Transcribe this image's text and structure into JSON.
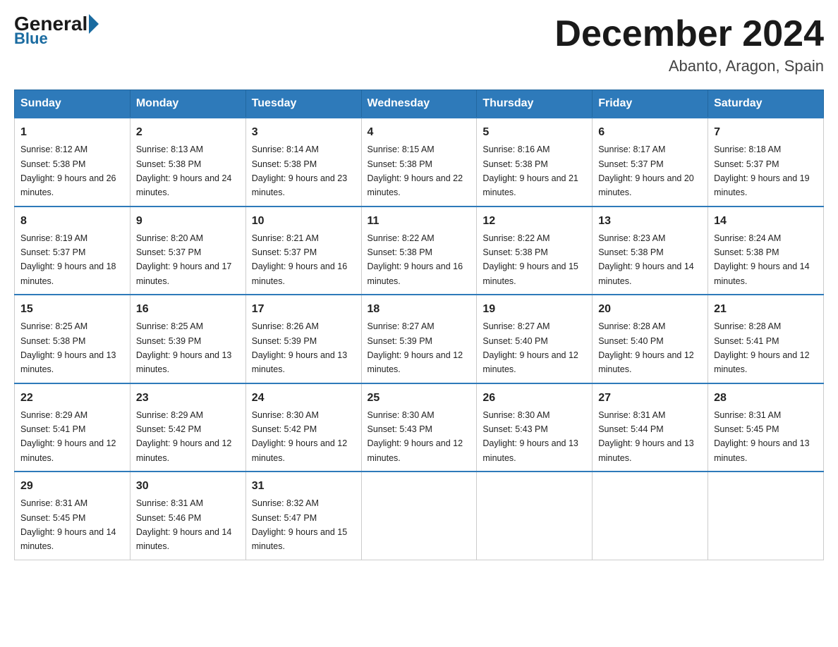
{
  "header": {
    "logo_general": "General",
    "logo_blue": "Blue",
    "month_title": "December 2024",
    "location": "Abanto, Aragon, Spain"
  },
  "days_of_week": [
    "Sunday",
    "Monday",
    "Tuesday",
    "Wednesday",
    "Thursday",
    "Friday",
    "Saturday"
  ],
  "weeks": [
    [
      {
        "day": "1",
        "sunrise": "8:12 AM",
        "sunset": "5:38 PM",
        "daylight": "9 hours and 26 minutes."
      },
      {
        "day": "2",
        "sunrise": "8:13 AM",
        "sunset": "5:38 PM",
        "daylight": "9 hours and 24 minutes."
      },
      {
        "day": "3",
        "sunrise": "8:14 AM",
        "sunset": "5:38 PM",
        "daylight": "9 hours and 23 minutes."
      },
      {
        "day": "4",
        "sunrise": "8:15 AM",
        "sunset": "5:38 PM",
        "daylight": "9 hours and 22 minutes."
      },
      {
        "day": "5",
        "sunrise": "8:16 AM",
        "sunset": "5:38 PM",
        "daylight": "9 hours and 21 minutes."
      },
      {
        "day": "6",
        "sunrise": "8:17 AM",
        "sunset": "5:37 PM",
        "daylight": "9 hours and 20 minutes."
      },
      {
        "day": "7",
        "sunrise": "8:18 AM",
        "sunset": "5:37 PM",
        "daylight": "9 hours and 19 minutes."
      }
    ],
    [
      {
        "day": "8",
        "sunrise": "8:19 AM",
        "sunset": "5:37 PM",
        "daylight": "9 hours and 18 minutes."
      },
      {
        "day": "9",
        "sunrise": "8:20 AM",
        "sunset": "5:37 PM",
        "daylight": "9 hours and 17 minutes."
      },
      {
        "day": "10",
        "sunrise": "8:21 AM",
        "sunset": "5:37 PM",
        "daylight": "9 hours and 16 minutes."
      },
      {
        "day": "11",
        "sunrise": "8:22 AM",
        "sunset": "5:38 PM",
        "daylight": "9 hours and 16 minutes."
      },
      {
        "day": "12",
        "sunrise": "8:22 AM",
        "sunset": "5:38 PM",
        "daylight": "9 hours and 15 minutes."
      },
      {
        "day": "13",
        "sunrise": "8:23 AM",
        "sunset": "5:38 PM",
        "daylight": "9 hours and 14 minutes."
      },
      {
        "day": "14",
        "sunrise": "8:24 AM",
        "sunset": "5:38 PM",
        "daylight": "9 hours and 14 minutes."
      }
    ],
    [
      {
        "day": "15",
        "sunrise": "8:25 AM",
        "sunset": "5:38 PM",
        "daylight": "9 hours and 13 minutes."
      },
      {
        "day": "16",
        "sunrise": "8:25 AM",
        "sunset": "5:39 PM",
        "daylight": "9 hours and 13 minutes."
      },
      {
        "day": "17",
        "sunrise": "8:26 AM",
        "sunset": "5:39 PM",
        "daylight": "9 hours and 13 minutes."
      },
      {
        "day": "18",
        "sunrise": "8:27 AM",
        "sunset": "5:39 PM",
        "daylight": "9 hours and 12 minutes."
      },
      {
        "day": "19",
        "sunrise": "8:27 AM",
        "sunset": "5:40 PM",
        "daylight": "9 hours and 12 minutes."
      },
      {
        "day": "20",
        "sunrise": "8:28 AM",
        "sunset": "5:40 PM",
        "daylight": "9 hours and 12 minutes."
      },
      {
        "day": "21",
        "sunrise": "8:28 AM",
        "sunset": "5:41 PM",
        "daylight": "9 hours and 12 minutes."
      }
    ],
    [
      {
        "day": "22",
        "sunrise": "8:29 AM",
        "sunset": "5:41 PM",
        "daylight": "9 hours and 12 minutes."
      },
      {
        "day": "23",
        "sunrise": "8:29 AM",
        "sunset": "5:42 PM",
        "daylight": "9 hours and 12 minutes."
      },
      {
        "day": "24",
        "sunrise": "8:30 AM",
        "sunset": "5:42 PM",
        "daylight": "9 hours and 12 minutes."
      },
      {
        "day": "25",
        "sunrise": "8:30 AM",
        "sunset": "5:43 PM",
        "daylight": "9 hours and 12 minutes."
      },
      {
        "day": "26",
        "sunrise": "8:30 AM",
        "sunset": "5:43 PM",
        "daylight": "9 hours and 13 minutes."
      },
      {
        "day": "27",
        "sunrise": "8:31 AM",
        "sunset": "5:44 PM",
        "daylight": "9 hours and 13 minutes."
      },
      {
        "day": "28",
        "sunrise": "8:31 AM",
        "sunset": "5:45 PM",
        "daylight": "9 hours and 13 minutes."
      }
    ],
    [
      {
        "day": "29",
        "sunrise": "8:31 AM",
        "sunset": "5:45 PM",
        "daylight": "9 hours and 14 minutes."
      },
      {
        "day": "30",
        "sunrise": "8:31 AM",
        "sunset": "5:46 PM",
        "daylight": "9 hours and 14 minutes."
      },
      {
        "day": "31",
        "sunrise": "8:32 AM",
        "sunset": "5:47 PM",
        "daylight": "9 hours and 15 minutes."
      },
      null,
      null,
      null,
      null
    ]
  ]
}
